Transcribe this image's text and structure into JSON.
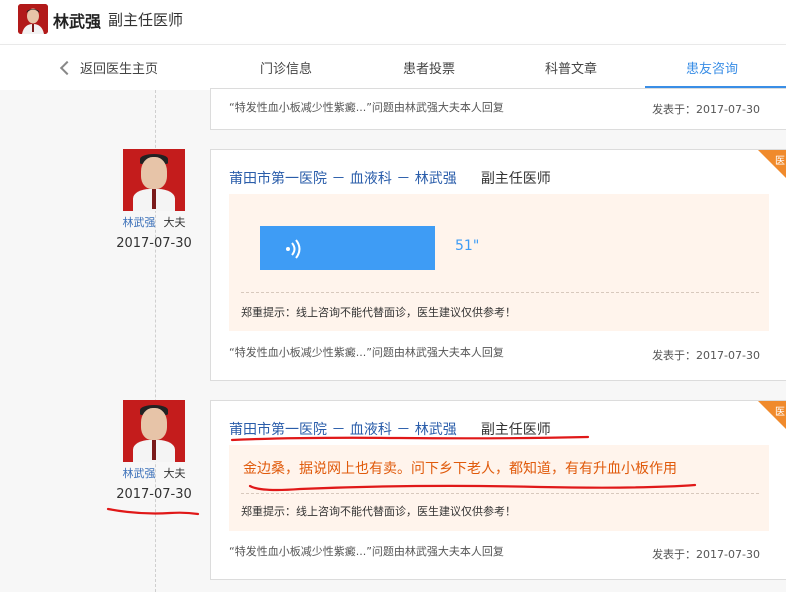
{
  "header": {
    "doctor_name": "林武强",
    "doctor_title": "副主任医师"
  },
  "nav": {
    "back_label": "返回医生主页",
    "tabs": [
      {
        "label": "门诊信息"
      },
      {
        "label": "患者投票"
      },
      {
        "label": "科普文章"
      },
      {
        "label": "患友咨询"
      }
    ],
    "active_tab": "患友咨询"
  },
  "top_card": {
    "topic": "“特发性血小板减少性紫癜...”问题由林武强大夫本人回复",
    "posted": "发表于：2017-07-30"
  },
  "replies": [
    {
      "doctor_link": "林武强",
      "role": "大夫",
      "date": "2017-07-30",
      "corner": "医",
      "hospital": "莆田市第一医院 － 血液科 － 林武强",
      "rank": "副主任医师",
      "audio_length": "51\"",
      "tip": "郑重提示：线上咨询不能代替面诊，医生建议仅供参考！",
      "topic": "“特发性血小板减少性紫癜...”问题由林武强大夫本人回复",
      "posted": "发表于：2017-07-30"
    },
    {
      "doctor_link": "林武强",
      "role": "大夫",
      "date": "2017-07-30",
      "corner": "医",
      "hospital": "莆田市第一医院 － 血液科 － 林武强",
      "rank": "副主任医师",
      "message": "金边桑，据说网上也有卖。问下乡下老人，都知道，有有升血小板作用",
      "tip": "郑重提示：线上咨询不能代替面诊，医生建议仅供参考！",
      "topic": "“特发性血小板减少性紫癜...”问题由林武强大夫本人回复",
      "posted": "发表于：2017-07-30"
    }
  ],
  "colors": {
    "accent_blue": "#3a8ee6",
    "hospital_link": "#2a5daa",
    "audio_button": "#3e9cf5",
    "message_orange": "#e05a0b",
    "bubble_bg": "#fff4ec",
    "corner_badge": "#f08a2c",
    "annotation_red": "#e01818"
  }
}
